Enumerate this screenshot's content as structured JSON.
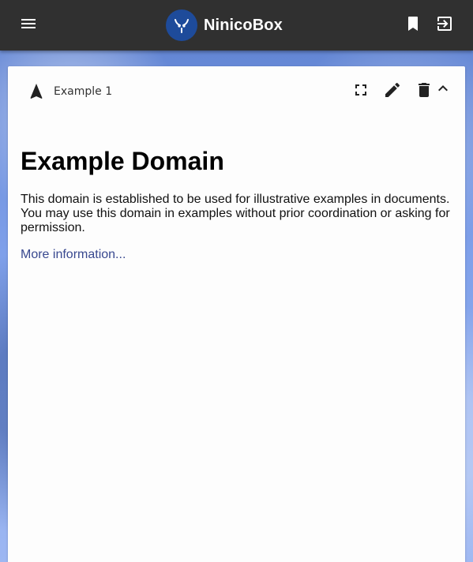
{
  "app": {
    "name": "NinicoBox",
    "logo_icon": "bull-logo-icon",
    "brand_color": "#1e4b9a",
    "topbar_color": "#303030"
  },
  "topbar": {
    "menu_icon": "menu-icon",
    "bookmark_icon": "bookmark-icon",
    "logout_icon": "logout-icon"
  },
  "card": {
    "title": "Example 1",
    "nav_icon": "navigation-arrow-icon",
    "actions": [
      "fullscreen-icon",
      "edit-icon",
      "delete-icon",
      "chevron-up-icon"
    ]
  },
  "page": {
    "heading": "Example Domain",
    "body": "This domain is established to be used for illustrative examples in documents. You may use this domain in examples without prior coordination or asking for permission.",
    "link_text": "More information...",
    "link_color": "#38488f"
  }
}
